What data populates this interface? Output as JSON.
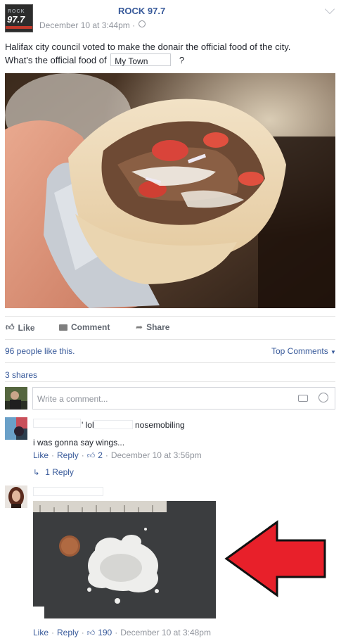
{
  "post": {
    "page_name": "ROCK 97.7",
    "logo_top": "ROCK",
    "logo_main": "97.7",
    "date": "December 10 at 3:44pm · ",
    "text_line1": "Halifax city council voted to make the donair the official food of the city.",
    "text_line2_before": "What's the official food of",
    "text_blank": "My Town",
    "text_line2_after": "?"
  },
  "actions": {
    "like": "Like",
    "comment": "Comment",
    "share": "Share"
  },
  "stats": {
    "likes": "96 people like this.",
    "top_comments": "Top Comments",
    "shares": "3 shares"
  },
  "composer": {
    "placeholder": "Write a comment..."
  },
  "comment1": {
    "name_part1": "' lol",
    "name_part2": "nosemobiling",
    "text": "i was gonna say wings...",
    "like": "Like",
    "reply": "Reply",
    "reactions": "2",
    "date": "December 10 at 3:56pm",
    "replies": "1 Reply"
  },
  "comment2": {
    "like": "Like",
    "reply": "Reply",
    "reactions": "190",
    "date": "December 10 at 3:48pm"
  },
  "colors": {
    "link": "#365899",
    "muted": "#90949c",
    "arrow": "#e8202a"
  }
}
